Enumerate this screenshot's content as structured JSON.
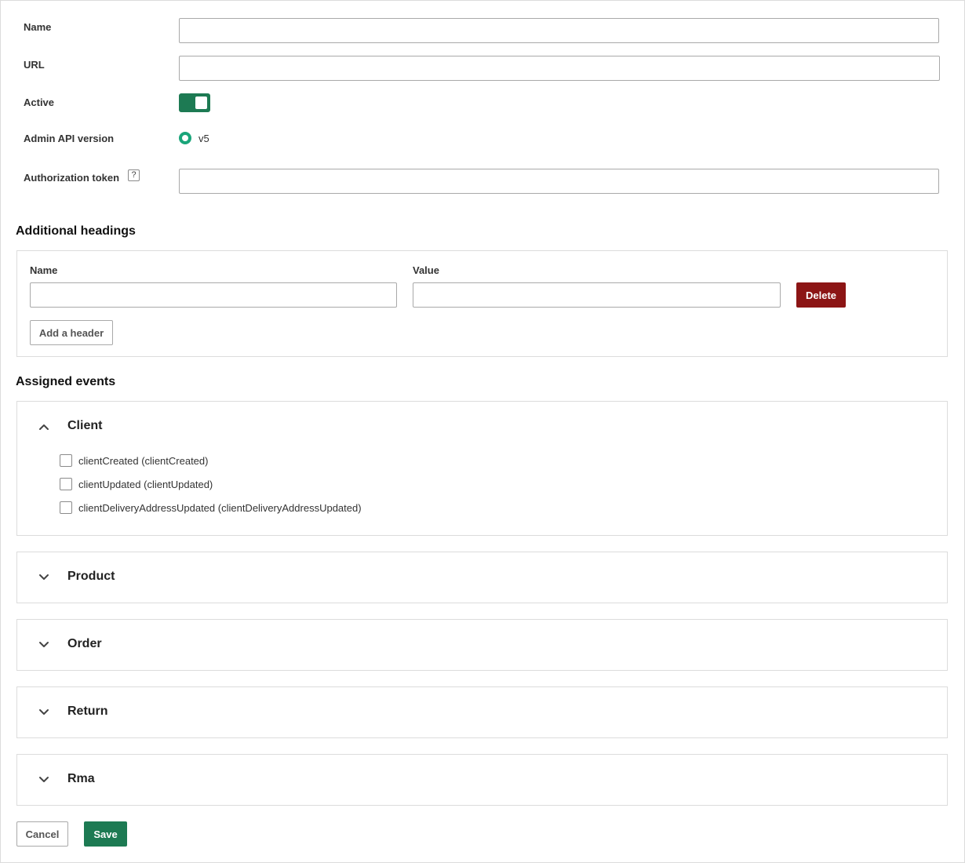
{
  "form": {
    "name_label": "Name",
    "name_value": "",
    "url_label": "URL",
    "url_value": "",
    "active_label": "Active",
    "active_on": true,
    "api_version_label": "Admin API version",
    "api_version_option": "v5",
    "token_label": "Authorization token",
    "token_help": "?",
    "token_value": ""
  },
  "additional_headings": {
    "title": "Additional headings",
    "name_col": "Name",
    "value_col": "Value",
    "rows": [
      {
        "name": "",
        "value": "",
        "delete_label": "Delete"
      }
    ],
    "add_label": "Add a header"
  },
  "assigned_events": {
    "title": "Assigned events",
    "groups": [
      {
        "title": "Client",
        "expanded": true,
        "events": [
          {
            "label": "clientCreated (clientCreated)",
            "checked": false
          },
          {
            "label": "clientUpdated (clientUpdated)",
            "checked": false
          },
          {
            "label": "clientDeliveryAddressUpdated (clientDeliveryAddressUpdated)",
            "checked": false
          }
        ]
      },
      {
        "title": "Product",
        "expanded": false
      },
      {
        "title": "Order",
        "expanded": false
      },
      {
        "title": "Return",
        "expanded": false
      },
      {
        "title": "Rma",
        "expanded": false
      }
    ]
  },
  "actions": {
    "cancel_label": "Cancel",
    "save_label": "Save"
  },
  "colors": {
    "primary": "#1d7a53",
    "danger": "#8c1515",
    "radio": "#1aa57a"
  }
}
